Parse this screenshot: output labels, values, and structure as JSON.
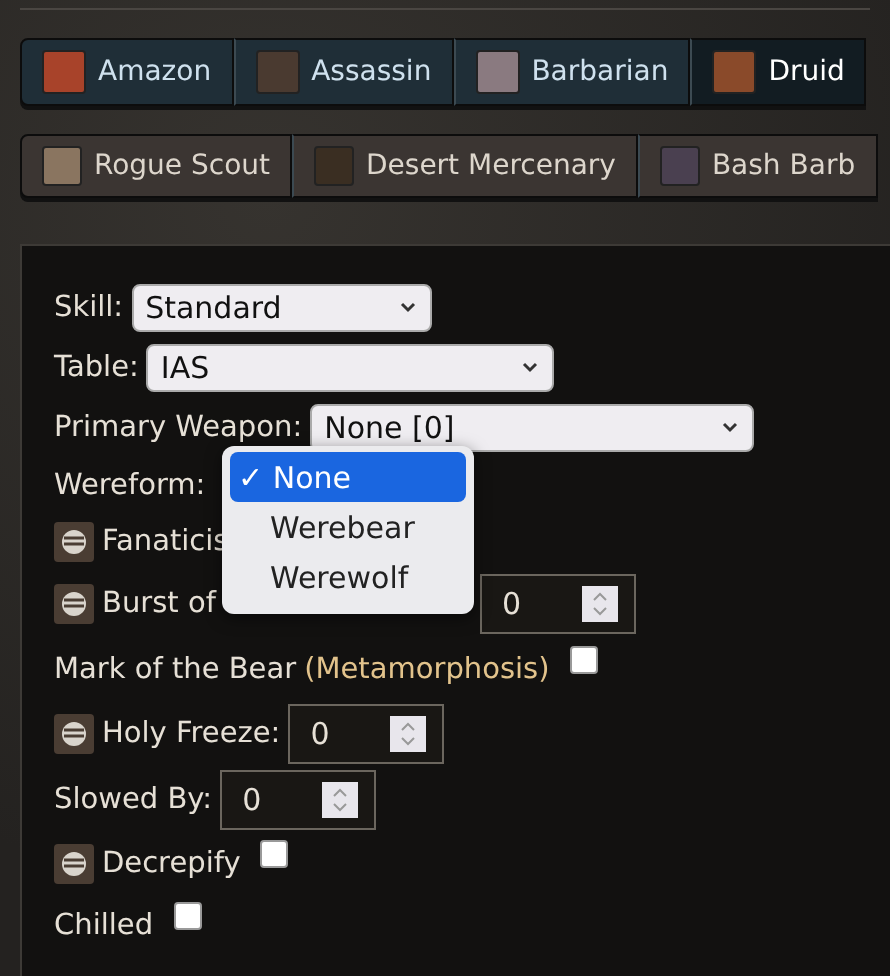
{
  "class_tabs": [
    {
      "label": "Amazon",
      "selected": false
    },
    {
      "label": "Assassin",
      "selected": false
    },
    {
      "label": "Barbarian",
      "selected": false
    },
    {
      "label": "Druid",
      "selected": true
    }
  ],
  "mercenary_tabs": [
    {
      "label": "Rogue Scout"
    },
    {
      "label": "Desert Mercenary"
    },
    {
      "label": "Bash Barb"
    }
  ],
  "form": {
    "rows": [
      {
        "kind": "select",
        "label": "Skill:",
        "value": "Standard"
      },
      {
        "kind": "select",
        "label": "Table:",
        "value": "IAS"
      },
      {
        "kind": "select",
        "label": "Primary Weapon:",
        "value": "None [0]"
      },
      {
        "kind": "open-select",
        "label": "Wereform:",
        "options": [
          {
            "label": "None",
            "mark": "✓",
            "selected": true
          },
          {
            "label": "Werebear",
            "selected": false
          },
          {
            "label": "Werewolf",
            "selected": false
          }
        ]
      },
      {
        "kind": "skill",
        "label": "Fanaticis"
      },
      {
        "kind": "skill-number",
        "label": "Burst of",
        "value": "0"
      },
      {
        "kind": "checkbox",
        "label": "Mark of the Bear",
        "note": "(Metamorphosis)",
        "checked": false
      },
      {
        "kind": "skill-number",
        "label": "Holy Freeze:",
        "value": "0"
      },
      {
        "kind": "number",
        "label": "Slowed By:",
        "value": "0"
      },
      {
        "kind": "skill-checkbox",
        "label": "Decrepify",
        "checked": false
      },
      {
        "kind": "checkbox",
        "label": "Chilled",
        "checked": false
      }
    ]
  }
}
